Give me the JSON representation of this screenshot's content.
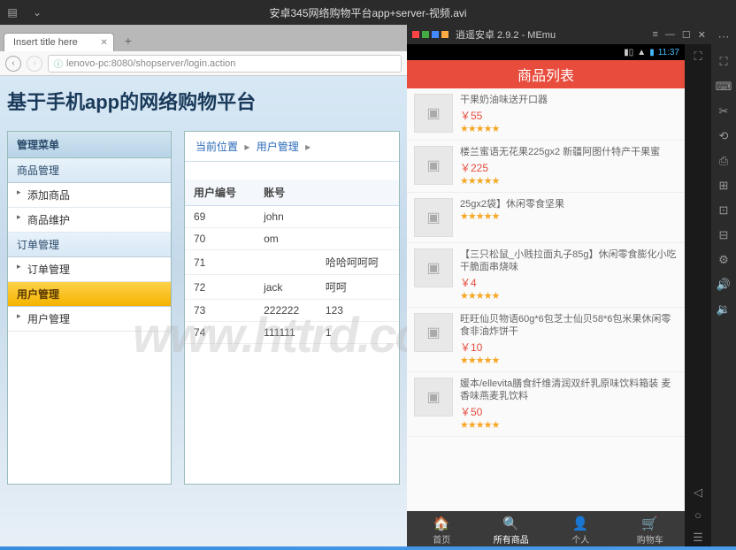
{
  "window_title": "安卓345网络购物平台app+server-视频.avi",
  "browser": {
    "tab_title": "Insert title here",
    "url": "lenovo-pc:8080/shopserver/login.action",
    "page_title": "基于手机app的网络购物平台",
    "menu_header": "管理菜单",
    "menu": [
      {
        "type": "group",
        "label": "商品管理"
      },
      {
        "type": "item",
        "label": "添加商品"
      },
      {
        "type": "item",
        "label": "商品维护"
      },
      {
        "type": "group",
        "label": "订单管理"
      },
      {
        "type": "item",
        "label": "订单管理"
      },
      {
        "type": "active",
        "label": "用户管理"
      },
      {
        "type": "item",
        "label": "用户管理"
      }
    ],
    "breadcrumb": {
      "current": "当前位置",
      "link": "用户管理"
    },
    "table": {
      "headers": [
        "用户编号",
        "账号",
        ""
      ],
      "rows": [
        [
          "69",
          "john",
          ""
        ],
        [
          "70",
          "om",
          ""
        ],
        [
          "71",
          "",
          "哈哈呵呵呵"
        ],
        [
          "72",
          "jack",
          "呵呵"
        ],
        [
          "73",
          "222222",
          "123"
        ],
        [
          "74",
          "111111",
          "1"
        ]
      ]
    },
    "watermark": "www.httrd.com"
  },
  "emulator": {
    "title": "逍遥安卓 2.9.2 - MEmu",
    "time": "11:37",
    "app_header": "商品列表",
    "products": [
      {
        "name": "干果奶油味送开口器",
        "price": "￥55"
      },
      {
        "name": "楼兰蜜语无花果225gx2 新疆阿图什特产干果蜜",
        "price": "￥225"
      },
      {
        "name": "25gx2袋】休闲零食坚果",
        "price": ""
      },
      {
        "name": "【三只松鼠_小贱拉面丸子85g】休闲零食膨化小吃干脆面串烧味",
        "price": "￥4"
      },
      {
        "name": "旺旺仙贝物语60g*6包芝士仙贝58*6包米果休闲零食非油炸饼干",
        "price": "￥10"
      },
      {
        "name": "媛本/ellevita膳食纤维清润双纤乳原味饮料箱装 麦香味燕麦乳饮料",
        "price": "￥50"
      }
    ],
    "nav": [
      {
        "icon": "🏠",
        "label": "首页"
      },
      {
        "icon": "🔍",
        "label": "所有商品",
        "active": true
      },
      {
        "icon": "👤",
        "label": "个人"
      },
      {
        "icon": "🛒",
        "label": "购物车"
      }
    ]
  }
}
